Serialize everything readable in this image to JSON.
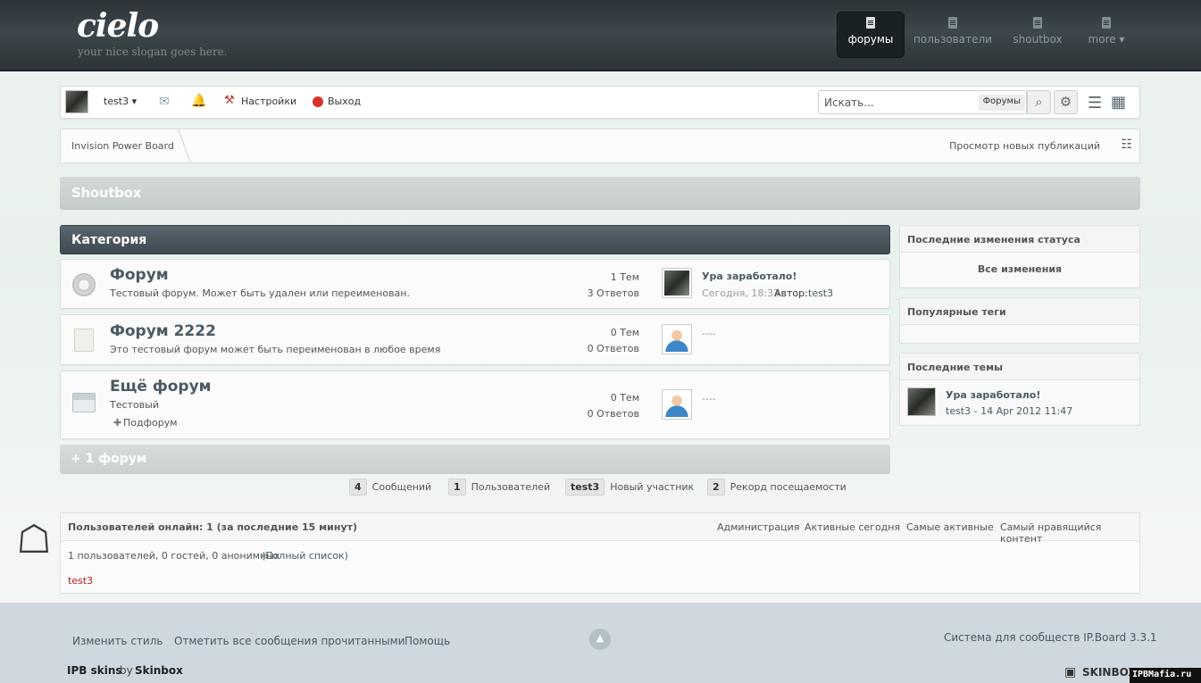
{
  "header": {
    "logo": "cielo",
    "slogan": "your nice slogan goes here.",
    "nav": [
      {
        "label": "форумы",
        "active": true
      },
      {
        "label": "пользователи",
        "active": false
      },
      {
        "label": "shoutbox",
        "active": false
      },
      {
        "label": "more ▾",
        "active": false
      }
    ]
  },
  "userbar": {
    "username": "test3 ▾",
    "settings": "Настройки",
    "logout": "Выход",
    "search_placeholder": "Искать...",
    "search_scope": "Форумы"
  },
  "breadcrumb": {
    "root": "Invision Power Board",
    "new_posts": "Просмотр новых публикаций"
  },
  "shoutbox": {
    "title": "Shoutbox"
  },
  "category": {
    "title": "Категория",
    "forums": [
      {
        "title": "Форум",
        "desc": "Тестовый форум. Может быть удален или переименован.",
        "topics": "1 Тем",
        "replies": "3 Ответов",
        "last_title": "Ура заработало!",
        "last_date": "Сегодня, 18:33",
        "last_author_label": "Автор:",
        "last_author": "test3"
      },
      {
        "title": "Форум 2222",
        "desc": "Это тестовый форум может быть переименован в любое время",
        "topics": "0 Тем",
        "replies": "0 Ответов",
        "last_title": "----"
      },
      {
        "title": "Ещё форум",
        "desc": "Тестовый",
        "subforum": "Подфорум",
        "topics": "0 Тем",
        "replies": "0 Ответов",
        "last_title": "----"
      }
    ],
    "more": "+ 1 форум"
  },
  "board_stats": [
    {
      "count": "4",
      "label": "Сообщений"
    },
    {
      "count": "1",
      "label": "Пользователей"
    },
    {
      "count": "test3",
      "label": "Новый участник"
    },
    {
      "count": "2",
      "label": "Рекорд посещаемости"
    }
  ],
  "sidebar": {
    "status": {
      "title": "Последние изменения статуса",
      "link": "Все изменения"
    },
    "tags": {
      "title": "Популярные теги"
    },
    "topics": {
      "title": "Последние темы",
      "item_title": "Ура заработало!",
      "item_meta": "test3 - 14 Apr 2012 11:47"
    }
  },
  "online": {
    "title": "Пользователей онлайн: 1 (за последние 15 минут)",
    "links": [
      "Администрация",
      "Активные сегодня",
      "Самые активные",
      "Самый нравящийся контент"
    ],
    "summary": "1 пользователей, 0 гостей, 0 анонимных",
    "full_list": "(Полный список)",
    "user": "test3"
  },
  "footer": {
    "links": [
      "Изменить стиль",
      "Отметить все сообщения прочитанными",
      "Помощь"
    ],
    "powered": "Система для сообществ IP.Board 3.3.1",
    "ipb_skins": "IPB skins",
    "by": "by",
    "skinbox": "Skinbox",
    "skinbox_logo": "SKINBOX",
    "watermark": "IPBMafia.ru"
  },
  "colors": {
    "accent": "#4b5a63",
    "online_user": "#b22222"
  }
}
